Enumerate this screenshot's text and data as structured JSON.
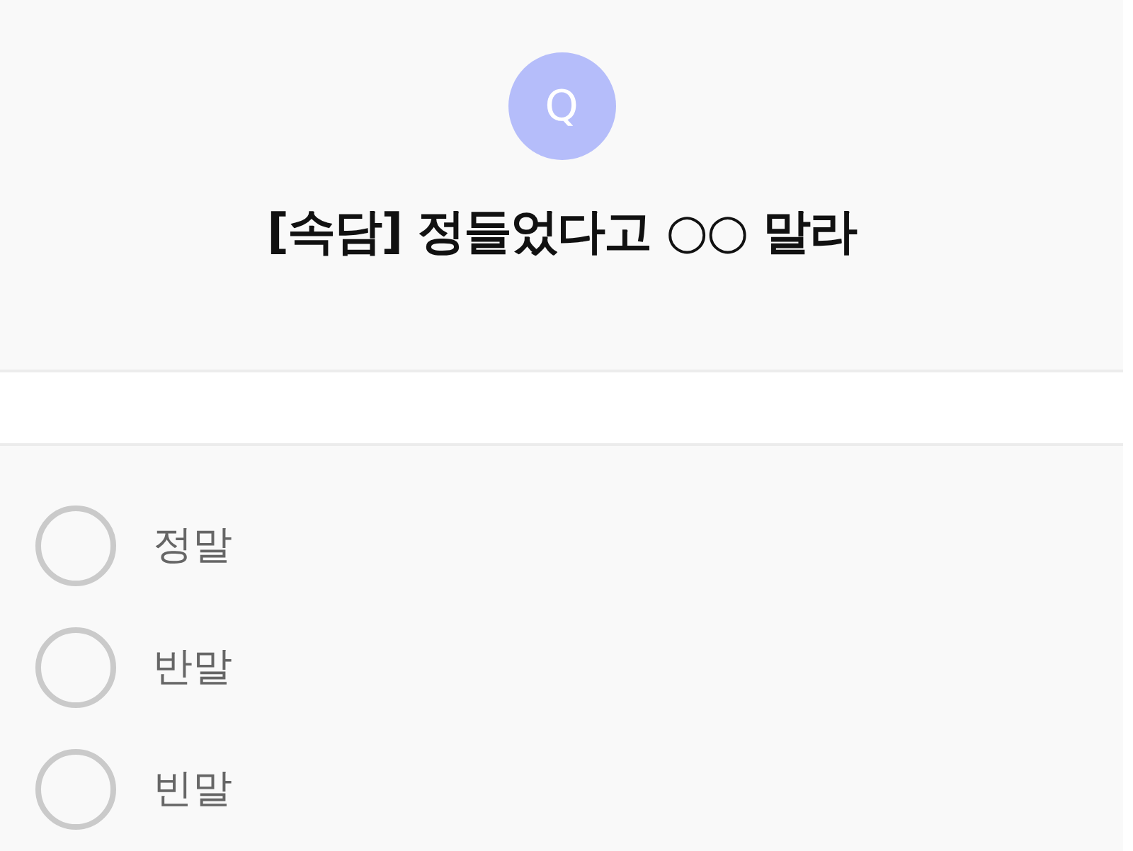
{
  "question": {
    "badge": "Q",
    "title": "[속담] 정들었다고 ○○ 말라"
  },
  "options": [
    {
      "label": "정말",
      "selected": false
    },
    {
      "label": "반말",
      "selected": false
    },
    {
      "label": "빈말",
      "selected": false
    }
  ]
}
